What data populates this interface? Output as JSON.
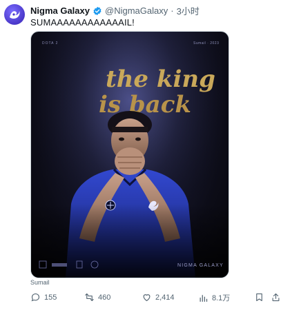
{
  "tweet": {
    "author_name": "Nigma Galaxy",
    "handle": "@NigmaGalaxy",
    "separator": "·",
    "time": "3小时",
    "text": "SUMAAAAAAAAAAAAIL!",
    "media_caption": "Sumail"
  },
  "poster": {
    "headline_line1": "the king",
    "headline_line2": "is back",
    "brand_bottom": "NIGMA GALAXY",
    "top_left_tag": "DOTA 2",
    "top_right_tag": "Sumail · 2023"
  },
  "actions": {
    "replies": "155",
    "reposts": "460",
    "likes": "2,414",
    "views": "8.1万"
  },
  "colors": {
    "accent": "#1d9bf0",
    "muted": "#536471",
    "jersey": "#2a3fb8"
  }
}
